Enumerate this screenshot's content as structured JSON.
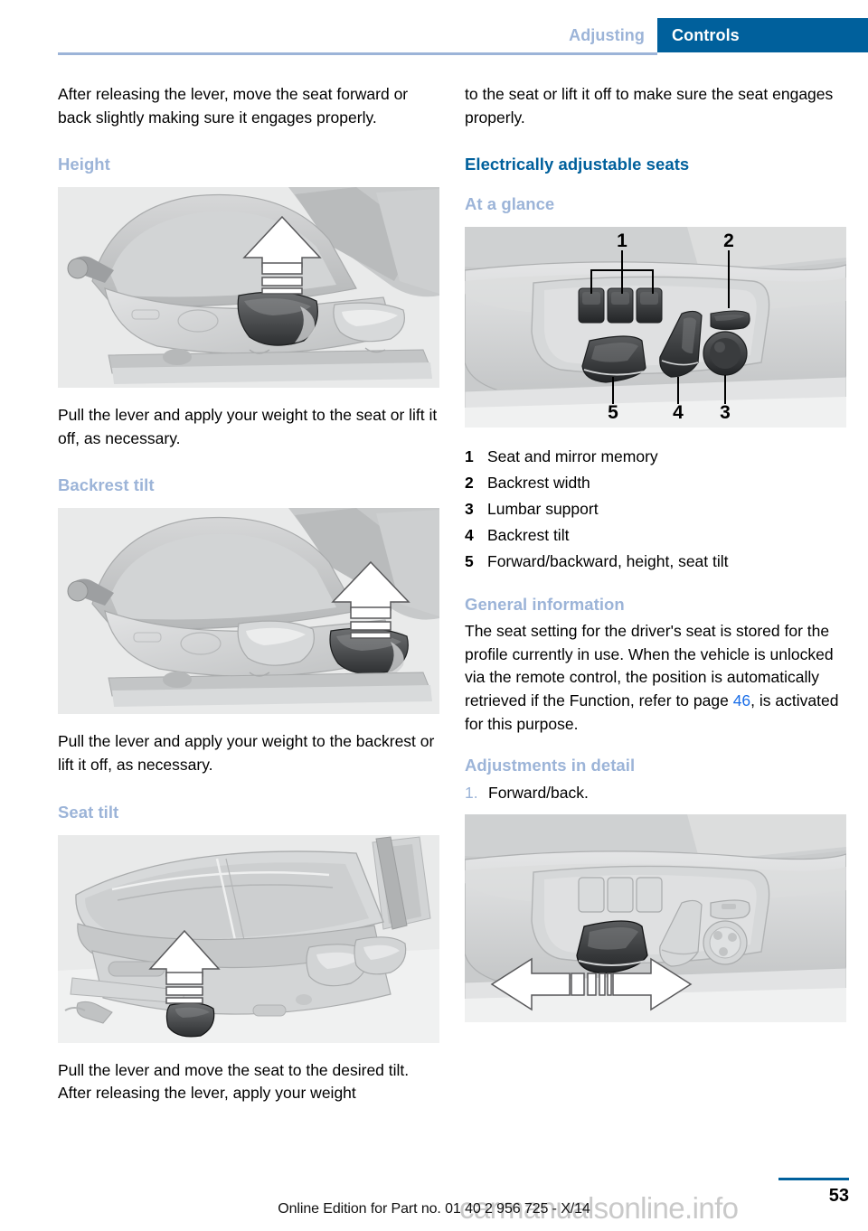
{
  "header": {
    "section_label": "Adjusting",
    "chapter_label": "Controls"
  },
  "left_column": {
    "intro_paragraph": "After releasing the lever, move the seat forward or back slightly making sure it engages properly.",
    "height_heading": "Height",
    "height_figure_alt": "seat-height-lever-illustration",
    "height_paragraph": "Pull the lever and apply your weight to the seat or lift it off, as necessary.",
    "backrest_tilt_heading": "Backrest tilt",
    "backrest_tilt_figure_alt": "backrest-tilt-lever-illustration",
    "backrest_tilt_paragraph": "Pull the lever and apply your weight to the backrest or lift it off, as necessary.",
    "seat_tilt_heading": "Seat tilt",
    "seat_tilt_figure_alt": "seat-tilt-lever-illustration",
    "seat_tilt_paragraph": "Pull the lever and move the seat to the desired tilt. After releasing the lever, apply your weight"
  },
  "right_column": {
    "continued_paragraph": "to the seat or lift it off to make sure the seat engages properly.",
    "main_heading": "Electrically adjustable seats",
    "at_a_glance_heading": "At a glance",
    "controls_figure_alt": "electric-seat-control-panel-illustration",
    "callouts": [
      {
        "number": "1",
        "label": "Seat and mirror memory"
      },
      {
        "number": "2",
        "label": "Backrest width"
      },
      {
        "number": "3",
        "label": "Lumbar support"
      },
      {
        "number": "4",
        "label": "Backrest tilt"
      },
      {
        "number": "5",
        "label": "Forward/backward, height, seat tilt"
      }
    ],
    "general_information_heading": "General information",
    "general_information_part1": "The seat setting for the driver's seat is stored for the profile currently in use. When the vehicle is unlocked via the remote control, the position is automatically retrieved if the Function, refer to page ",
    "general_information_page_ref": "46",
    "general_information_part2": ", is activated for this purpose.",
    "adjustments_heading": "Adjustments in detail",
    "steps": [
      {
        "number": "1.",
        "label": "Forward/back."
      }
    ],
    "forward_back_figure_alt": "seat-forward-backward-control-illustration"
  },
  "footer": {
    "page_number": "53",
    "edition_text": "Online Edition for Part no. 01 40 2 956 725 - X/14",
    "watermark_text": "carmanualsonline.info"
  },
  "colors": {
    "chapter_tab_blue": "#00609c",
    "section_label_blue": "#9cb4d8",
    "heading_major_blue": "#00609c",
    "heading_minor_blue": "#9cb4d8",
    "link_blue": "#1a6ee8",
    "figure_background": "#e9eaea"
  }
}
